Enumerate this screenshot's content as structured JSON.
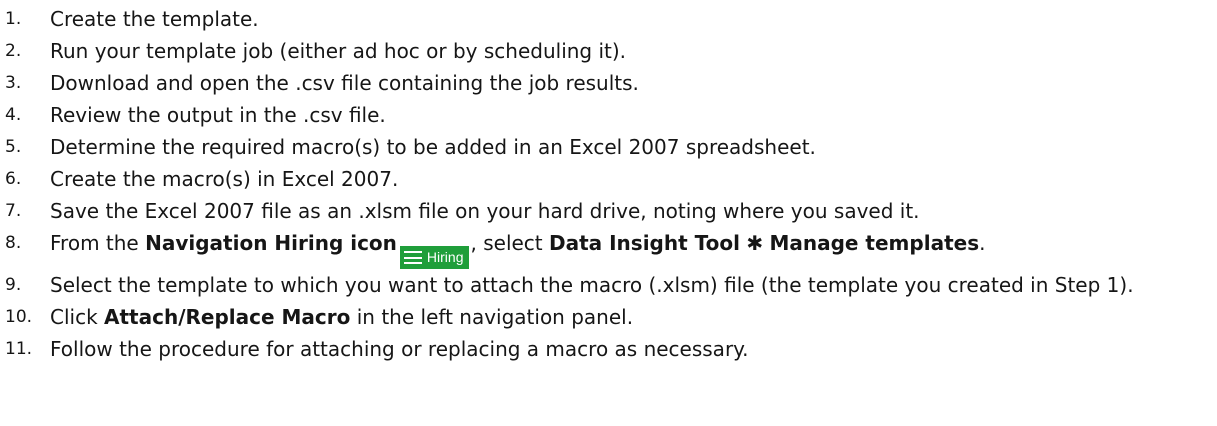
{
  "steps": [
    {
      "num": "1.",
      "text": "Create the template."
    },
    {
      "num": "2.",
      "text": "Run your template job (either ad hoc or by scheduling it)."
    },
    {
      "num": "3.",
      "text": "Download and open the .csv file containing the job results."
    },
    {
      "num": "4.",
      "text": "Review the output in the .csv file."
    },
    {
      "num": "5.",
      "text": "Determine the required macro(s) to be added in an Excel 2007 spreadsheet."
    },
    {
      "num": "6.",
      "text": "Create the macro(s) in Excel 2007."
    },
    {
      "num": "7.",
      "text": "Save the Excel 2007 file as an .xlsm file on your hard drive, noting where you saved it."
    },
    {
      "num": "8.",
      "prefix": "From the ",
      "nav_bold": "Navigation Hiring icon",
      "icon_label": "Hiring",
      "icon_name": "hamburger-menu-icon",
      "icon_color": "#1f9e3a",
      "middle": ", select ",
      "tool_bold": "Data Insight Tool",
      "separator": "✱",
      "manage_bold": "Manage templates",
      "suffix": "."
    },
    {
      "num": "9.",
      "text": "Select the template to which you want to attach the macro (.xlsm) file (the template you created in Step 1)."
    },
    {
      "num": "10.",
      "prefix": "Click ",
      "bold": "Attach/Replace Macro",
      "suffix": " in the left navigation panel."
    },
    {
      "num": "11.",
      "text": "Follow the procedure for attaching or replacing a macro as necessary."
    }
  ]
}
